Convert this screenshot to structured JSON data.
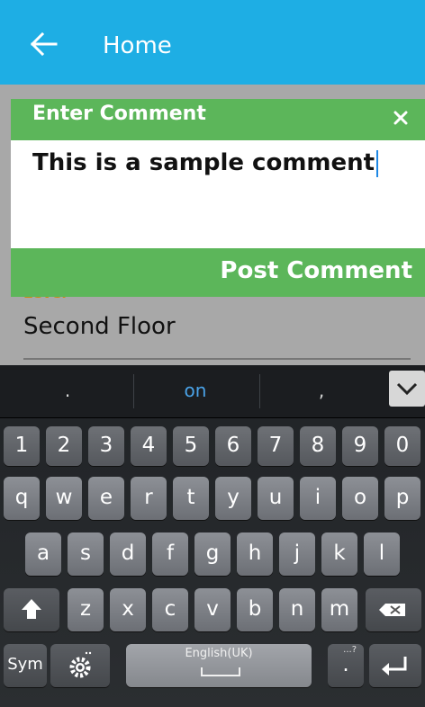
{
  "appbar": {
    "title": "Home",
    "back_icon": "arrow-left-icon",
    "color": "#1eaee4"
  },
  "background_form": {
    "field_label": "Level",
    "field_value": "Second Floor"
  },
  "dialog": {
    "title": "Enter Comment",
    "close_icon": "close-icon",
    "comment_text": "This is a sample comment",
    "post_label": "Post Comment",
    "accent": "#5cb65a"
  },
  "keyboard": {
    "suggestions": [
      ".",
      "on",
      ","
    ],
    "collapse_icon": "chevron-down-icon",
    "number_row": [
      "1",
      "2",
      "3",
      "4",
      "5",
      "6",
      "7",
      "8",
      "9",
      "0"
    ],
    "row1": [
      "q",
      "w",
      "e",
      "r",
      "t",
      "y",
      "u",
      "i",
      "o",
      "p"
    ],
    "row2": [
      "a",
      "s",
      "d",
      "f",
      "g",
      "h",
      "j",
      "k",
      "l"
    ],
    "row3": [
      "z",
      "x",
      "c",
      "v",
      "b",
      "n",
      "m"
    ],
    "shift_icon": "shift-arrow-icon",
    "backspace_icon": "backspace-icon",
    "sym_label": "Sym",
    "settings_icon": "gear-icon",
    "space_label": "English(UK)",
    "period_label": ".",
    "period_sup": "...?",
    "enter_icon": "enter-icon"
  }
}
